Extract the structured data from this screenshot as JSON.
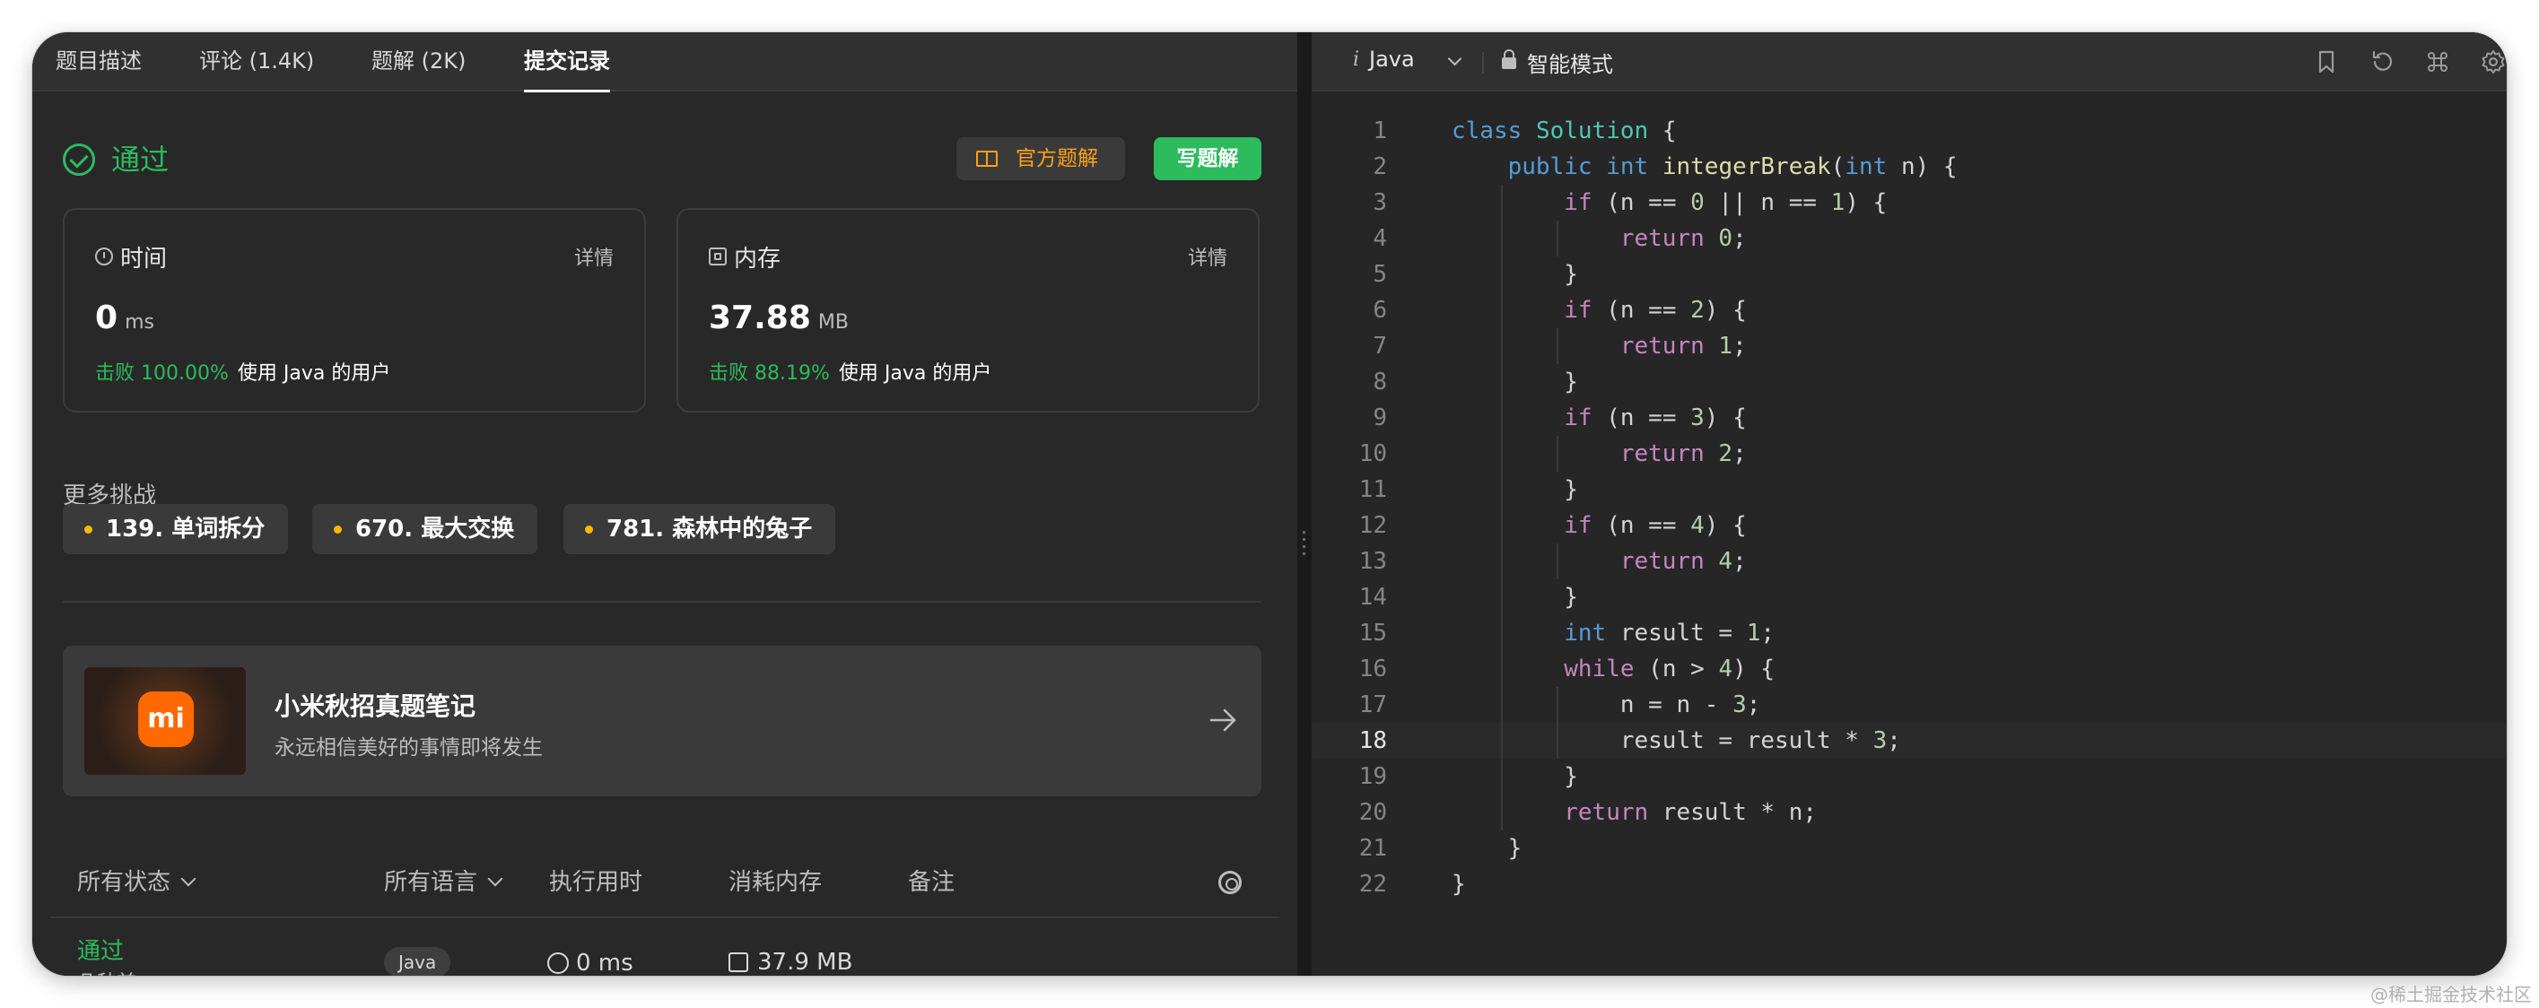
{
  "tabs": [
    {
      "label": "题目描述"
    },
    {
      "label": "评论 (1.4K)"
    },
    {
      "label": "题解 (2K)"
    },
    {
      "label": "提交记录"
    }
  ],
  "result": {
    "status": "通过",
    "official_solution_label": "官方题解",
    "write_solution_label": "写题解"
  },
  "time_card": {
    "title": "时间",
    "detail": "详情",
    "value": "0",
    "unit": "ms",
    "beat": "击败 100.00%",
    "suffix": "使用 Java 的用户"
  },
  "memory_card": {
    "title": "内存",
    "detail": "详情",
    "value": "37.88",
    "unit": "MB",
    "beat": "击败 88.19%",
    "suffix": "使用 Java 的用户"
  },
  "more_challenges": {
    "title": "更多挑战",
    "items": [
      {
        "label": "139. 单词拆分"
      },
      {
        "label": "670. 最大交换"
      },
      {
        "label": "781. 森林中的兔子"
      }
    ]
  },
  "banner": {
    "logo_text": "mi",
    "title": "小米秋招真题笔记",
    "subtitle": "永远相信美好的事情即将发生"
  },
  "table": {
    "headers": {
      "status": "所有状态",
      "language": "所有语言",
      "runtime": "执行用时",
      "memory": "消耗内存",
      "notes": "备注"
    },
    "rows": [
      {
        "status": "通过",
        "time_ago": "几秒前",
        "language": "Java",
        "runtime": "0 ms",
        "memory": "37.9 MB"
      }
    ]
  },
  "editor": {
    "language": "Java",
    "mode": "智能模式",
    "current_line": 18,
    "code": [
      "class Solution {",
      "    public int integerBreak(int n) {",
      "        if (n == 0 || n == 1) {",
      "            return 0;",
      "        }",
      "        if (n == 2) {",
      "            return 1;",
      "        }",
      "        if (n == 3) {",
      "            return 2;",
      "        }",
      "        if (n == 4) {",
      "            return 4;",
      "        }",
      "        int result = 1;",
      "        while (n > 4) {",
      "            n = n - 3;",
      "            result = result * 3;",
      "        }",
      "        return result * n;",
      "    }",
      "}"
    ]
  },
  "icons": {
    "status": "check-circle-icon",
    "official": "book-icon",
    "time": "stopwatch-icon",
    "memory": "chip-icon",
    "banner_arrow": "arrow-right-icon",
    "settings": "gear-icon",
    "editor_tools": [
      "bookmark-icon",
      "reset-icon",
      "command-icon",
      "gear-icon"
    ]
  },
  "colors": {
    "accept_green": "#2cbb5d",
    "orange": "#ffa116",
    "panel_bg": "#282828",
    "editor_bg": "#262626"
  },
  "watermark": "@稀土掘金技术社区"
}
